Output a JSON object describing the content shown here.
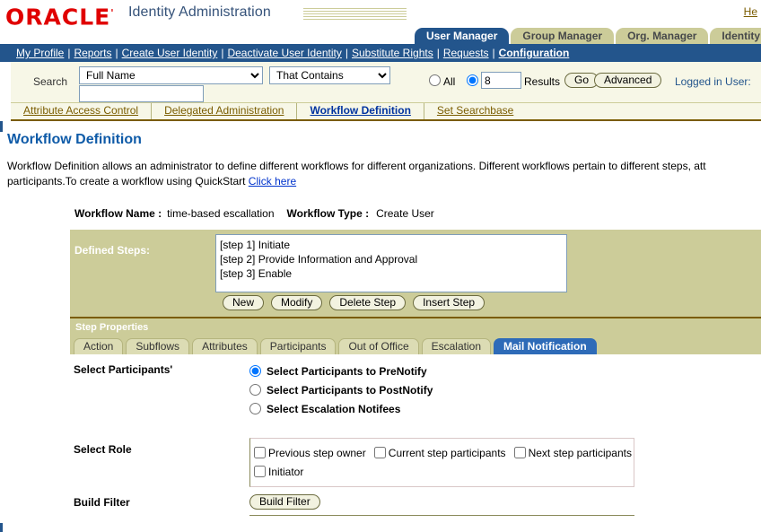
{
  "brand": {
    "logo_text": "ORACLE",
    "logo_tick": "'",
    "app_title": "Identity Administration",
    "help_label": "He"
  },
  "product_tabs": [
    {
      "label": "User Manager",
      "active": true
    },
    {
      "label": "Group Manager",
      "active": false
    },
    {
      "label": "Org. Manager",
      "active": false
    },
    {
      "label": "Identity S",
      "active": false
    }
  ],
  "nav_links": [
    {
      "label": "My Profile",
      "current": false
    },
    {
      "label": "Reports",
      "current": false
    },
    {
      "label": "Create User Identity",
      "current": false
    },
    {
      "label": "Deactivate User Identity",
      "current": false
    },
    {
      "label": "Substitute Rights",
      "current": false
    },
    {
      "label": "Requests",
      "current": false
    },
    {
      "label": "Configuration",
      "current": true
    }
  ],
  "nav_separator": "|",
  "search": {
    "label": "Search",
    "attribute_value": "Full Name",
    "operator_value": "That Contains",
    "query_value": "",
    "query_placeholder": "",
    "all_label": "All",
    "count_value": "8",
    "results_label": "Results",
    "go_label": "Go",
    "advanced_label": "Advanced",
    "logged_in_user": "Logged in User: ",
    "scope": "count"
  },
  "sub_tabs": [
    {
      "label": "Attribute Access Control",
      "active": false
    },
    {
      "label": "Delegated Administration",
      "active": false
    },
    {
      "label": "Workflow Definition",
      "active": true
    },
    {
      "label": "Set Searchbase",
      "active": false
    }
  ],
  "page": {
    "title": "Workflow Definition",
    "description_part1": "Workflow Definition allows an administrator to define different workflows for different organizations. Different workflows pertain to different steps, att",
    "description_part2": "participants.To create a workflow using QuickStart ",
    "description_link": "Click here"
  },
  "workflow": {
    "name_label": "Workflow Name :",
    "name_value": "time-based escallation",
    "type_label": "Workflow Type :",
    "type_value": "Create User",
    "defined_steps_label": "Defined Steps:",
    "steps": [
      "[step 1] Initiate",
      "[step 2] Provide Information and Approval",
      "[step 3] Enable"
    ],
    "step_buttons": [
      "New",
      "Modify",
      "Delete Step",
      "Insert Step"
    ]
  },
  "step_properties": {
    "header": "Step Properties",
    "tabs": [
      {
        "label": "Action",
        "active": false
      },
      {
        "label": "Subflows",
        "active": false
      },
      {
        "label": "Attributes",
        "active": false
      },
      {
        "label": "Participants",
        "active": false
      },
      {
        "label": "Out of Office",
        "active": false
      },
      {
        "label": "Escalation",
        "active": false
      },
      {
        "label": "Mail Notification",
        "active": true
      }
    ]
  },
  "form": {
    "select_participants_label": "Select Participants'",
    "participant_options": [
      {
        "label": "Select Participants to PreNotify",
        "selected": true
      },
      {
        "label": "Select Participants to PostNotify",
        "selected": false
      },
      {
        "label": "Select Escalation Notifees",
        "selected": false
      }
    ],
    "select_role_label": "Select Role",
    "role_options_row1": [
      {
        "label": "Previous step owner",
        "checked": false
      },
      {
        "label": "Current step participants",
        "checked": false
      },
      {
        "label": "Next step participants",
        "checked": false
      }
    ],
    "role_options_row2": [
      {
        "label": "Initiator",
        "checked": false
      }
    ],
    "build_filter_label": "Build Filter",
    "build_filter_button": "Build Filter"
  },
  "colors": {
    "brand_red": "#e00000",
    "nav_blue": "#23558c",
    "khaki": "#cccc99",
    "tab_active_blue": "#2e6bb8",
    "link_gold": "#7a5c00",
    "title_blue": "#0f5ba8"
  }
}
